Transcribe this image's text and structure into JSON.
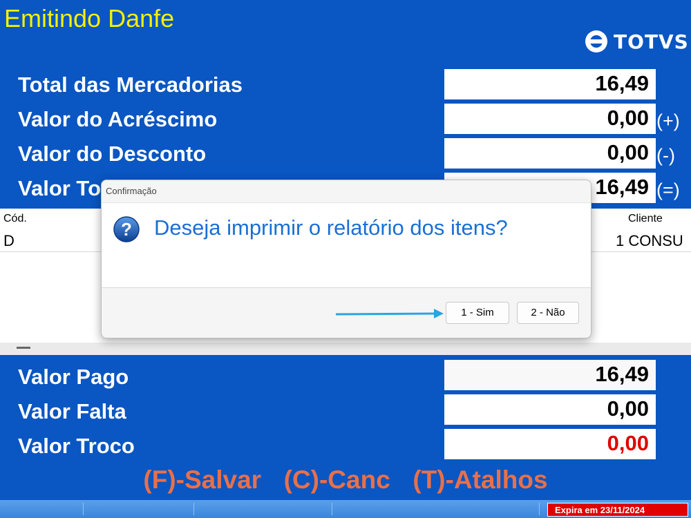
{
  "window_title": "Emitindo Danfe",
  "logo": {
    "text": "TOTVS",
    "icon": "totvs-logo-icon"
  },
  "totals": {
    "total_mercadorias": {
      "label": "Total das Mercadorias",
      "value": "16,49"
    },
    "acrescimo": {
      "label": "Valor do Acréscimo",
      "value": "0,00",
      "op": "(+)"
    },
    "desconto": {
      "label": "Valor do Desconto",
      "value": "0,00",
      "op": "(-)"
    },
    "total": {
      "label": "Valor To",
      "value": "16,49",
      "op": "(=)"
    }
  },
  "grid": {
    "col_cod": "Cód.",
    "col_cliente": "Cliente",
    "row_cod": "D",
    "row_cliente": "1 CONSU"
  },
  "payment": {
    "pago": {
      "label": "Valor Pago",
      "value": "16,49"
    },
    "falta": {
      "label": "Valor Falta",
      "value": "0,00"
    },
    "troco": {
      "label": "Valor Troco",
      "value": "0,00"
    }
  },
  "dialog": {
    "title": "Confirmação",
    "message": "Deseja imprimir o relatório dos itens?",
    "icon": "question-icon",
    "btn_sim": "1 - Sim",
    "btn_nao": "2 - Não"
  },
  "shortcuts": "(F)-Salvar  (C)-Canc  (T)-Atalhos",
  "status": {
    "expire": "Expira em 23/11/2024"
  },
  "colors": {
    "background": "#0a56c2",
    "title": "#f5f000",
    "shortcuts": "#e8704a",
    "troco_value": "#e00000",
    "dialog_message": "#1a6fd6"
  }
}
